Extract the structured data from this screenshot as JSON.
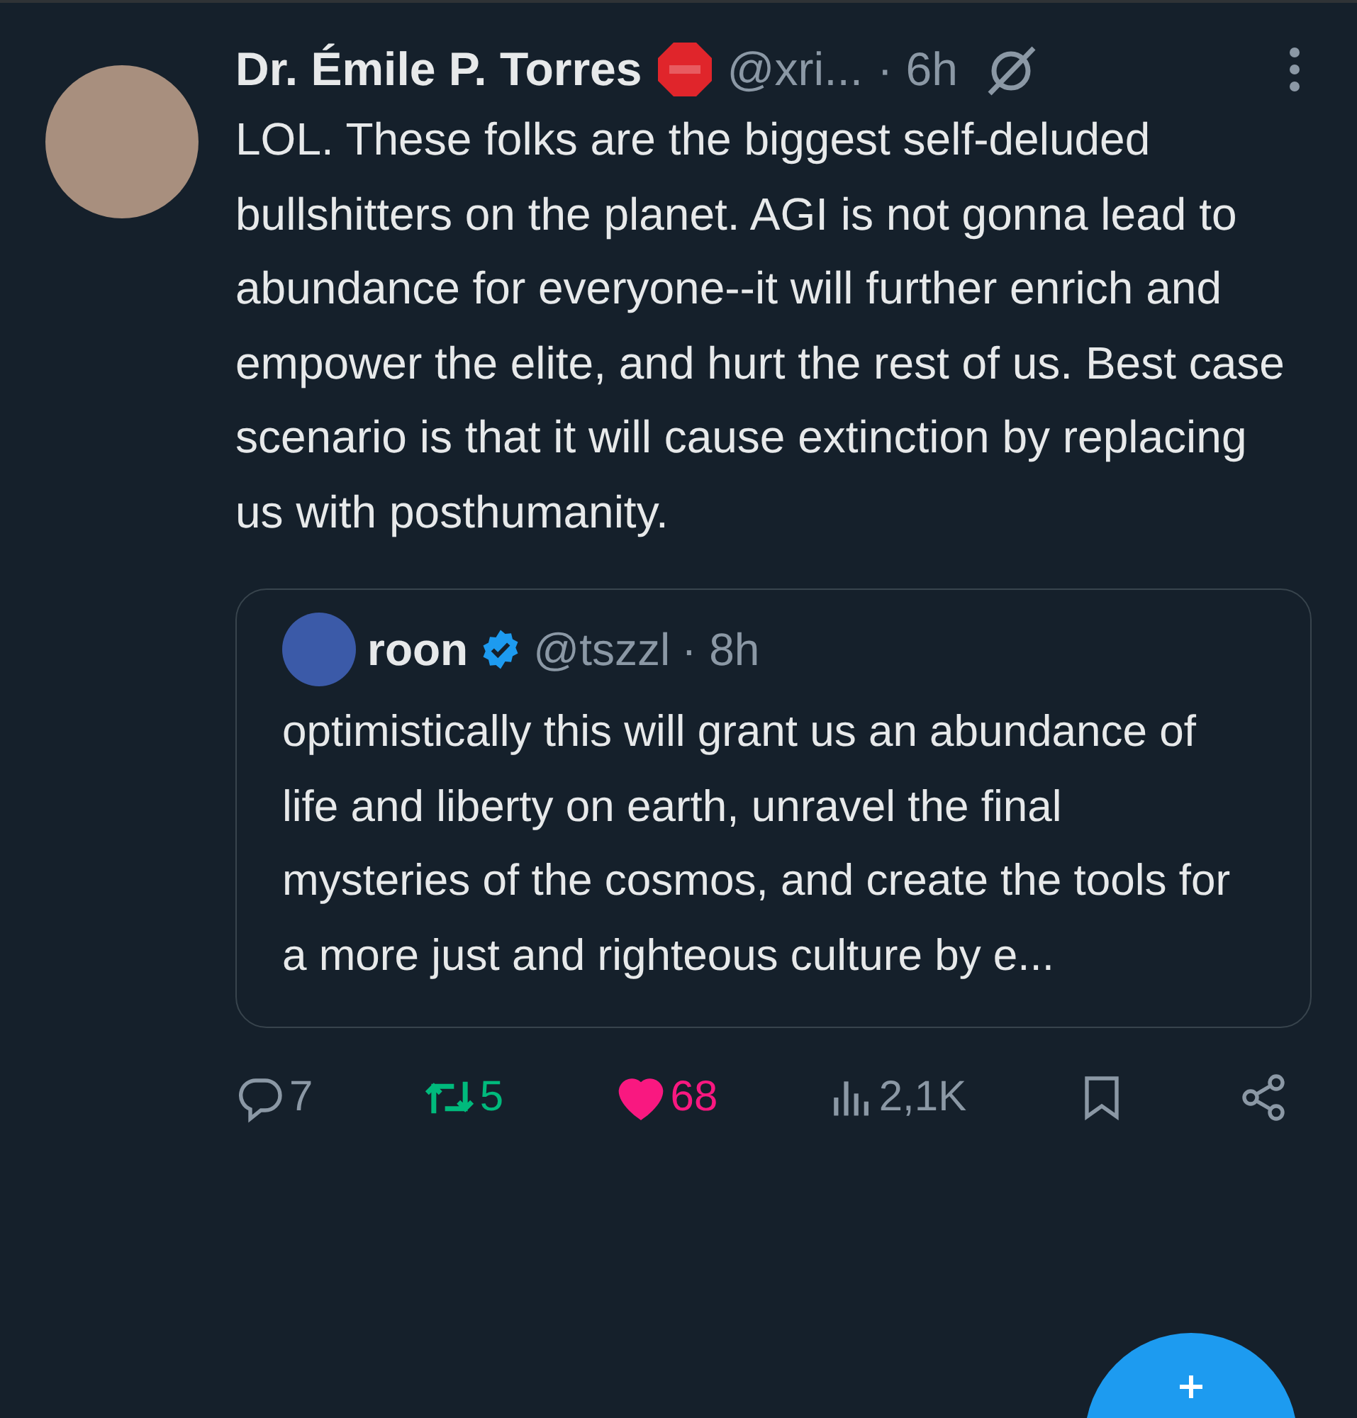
{
  "tweet": {
    "name": "Dr. Émile P. Torres",
    "handle": "@xri...",
    "time": "· 6h",
    "text": "LOL. These folks are the biggest self-deluded bullshitters on the planet. AGI is not gonna lead to abundance for everyone--it will further enrich and empower the elite, and hurt the rest of us. Best case scenario is that it will cause extinction by replacing us with posthumanity.",
    "quote": {
      "name": "roon",
      "verified": true,
      "handle": "@tszzl",
      "time": "· 8h",
      "text": "optimistically this will grant us an abundance of life and liberty on earth, unravel the final mysteries of the cosmos, and create the tools for a more just and righteous culture by e..."
    },
    "actions": [
      {
        "kind": "reply",
        "count": "7",
        "selected": false
      },
      {
        "kind": "retweet",
        "count": "5",
        "selected": true
      },
      {
        "kind": "like",
        "count": "68",
        "selected": true
      },
      {
        "kind": "views",
        "count": "2,1K",
        "selected": false
      },
      {
        "kind": "bookmark",
        "selected": false
      },
      {
        "kind": "share",
        "selected": false
      }
    ]
  }
}
